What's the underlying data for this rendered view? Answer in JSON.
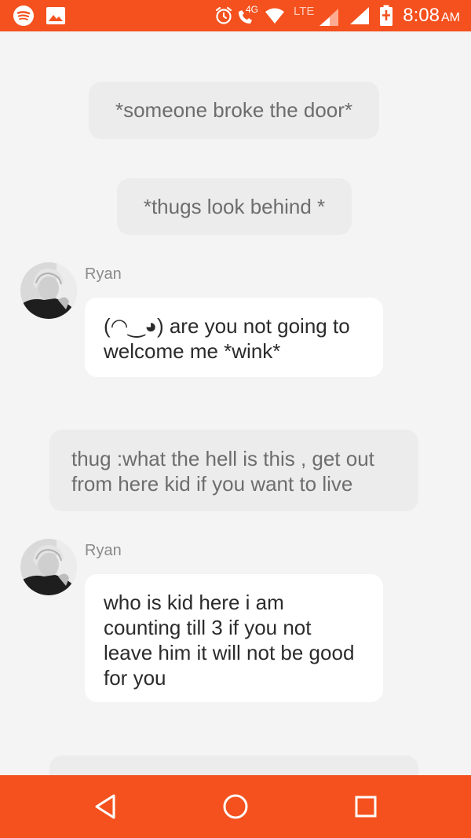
{
  "status_bar": {
    "time": "8:08",
    "ampm": "AM",
    "network_label": "4G",
    "lte_label": "LTE",
    "icons": [
      "spotify-icon",
      "gallery-icon",
      "alarm-icon",
      "call-4g-icon",
      "wifi-icon",
      "signal-lte-icon",
      "signal-icon",
      "battery-charging-icon"
    ]
  },
  "chat": {
    "narration_1": "*someone broke the door*",
    "narration_2": "*thugs look behind *",
    "message_1": {
      "name": "Ryan",
      "text": "(◠‿◕) are you not going to welcome me *wink*"
    },
    "narration_3": "thug :what the hell is this , get out from here kid if you want to live",
    "message_2": {
      "name": "Ryan",
      "text": "who is kid  here i am counting till 3 if you not leave him it will not be good for you"
    }
  },
  "colors": {
    "accent": "#f4511e",
    "background": "#f4f4f5",
    "narration_bubble": "#ececed",
    "character_bubble": "#ffffff"
  },
  "nav_bar": {
    "icons": [
      "back-triangle-icon",
      "home-circle-icon",
      "recents-square-icon"
    ]
  }
}
